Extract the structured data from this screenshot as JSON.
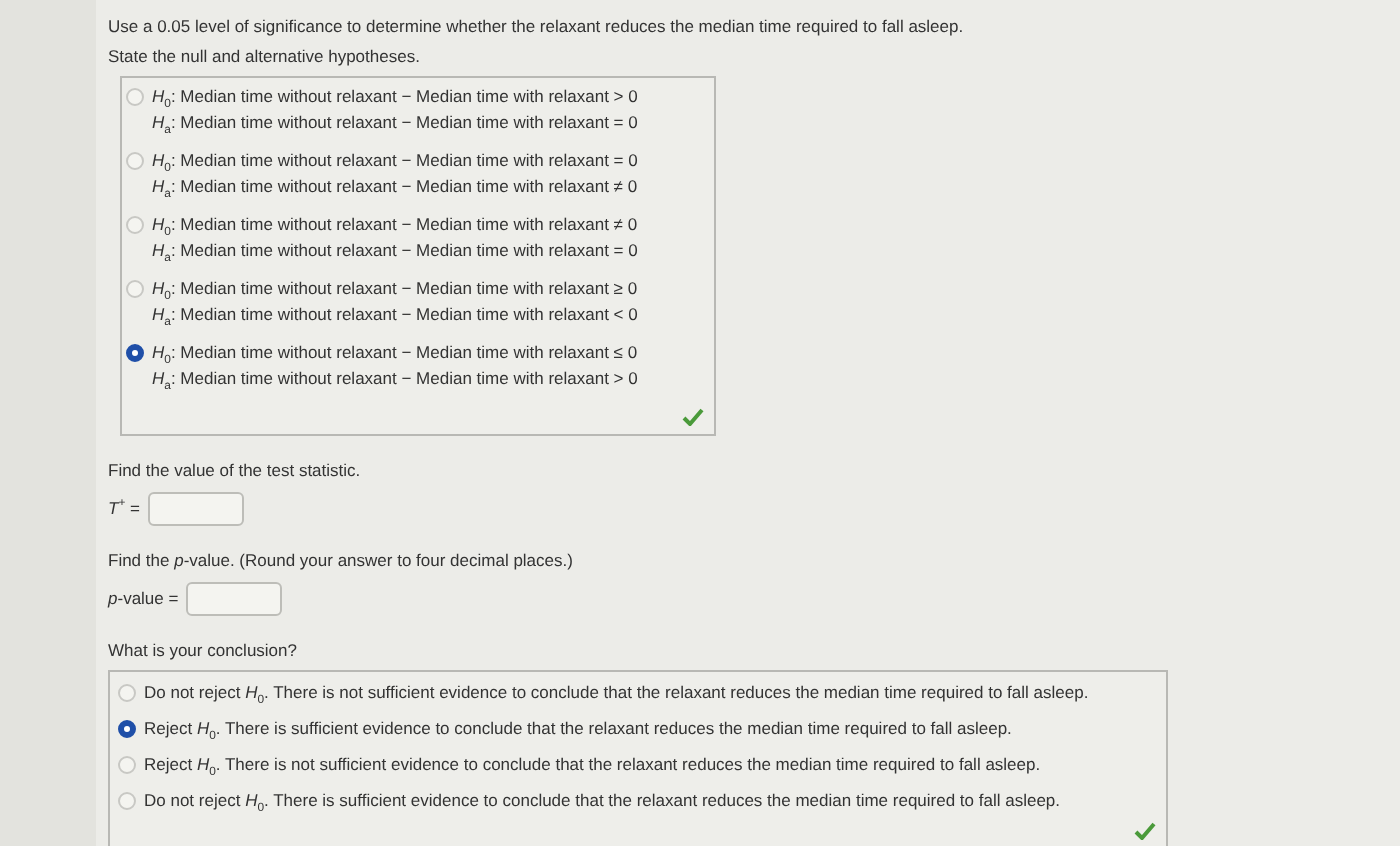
{
  "intro": "Use a 0.05 level of significance to determine whether the relaxant reduces the median time required to fall asleep.",
  "hypotheses": {
    "prompt": "State the null and alternative hypotheses.",
    "correct": true,
    "options": [
      {
        "h0": "*H*$_{0}$: Median time without relaxant − Median time with relaxant > 0",
        "ha": "*H*$_{a}$: Median time without relaxant − Median time with relaxant = 0",
        "selected": false
      },
      {
        "h0": "*H*$_{0}$: Median time without relaxant − Median time with relaxant = 0",
        "ha": "*H*$_{a}$: Median time without relaxant − Median time with relaxant ≠ 0",
        "selected": false
      },
      {
        "h0": "*H*$_{0}$: Median time without relaxant − Median time with relaxant ≠ 0",
        "ha": "*H*$_{a}$: Median time without relaxant − Median time with relaxant = 0",
        "selected": false
      },
      {
        "h0": "*H*$_{0}$: Median time without relaxant − Median time with relaxant ≥ 0",
        "ha": "*H*$_{a}$: Median time without relaxant − Median time with relaxant < 0",
        "selected": false
      },
      {
        "h0": "*H*$_{0}$: Median time without relaxant − Median time with relaxant ≤ 0",
        "ha": "*H*$_{a}$: Median time without relaxant − Median time with relaxant > 0",
        "selected": true
      }
    ]
  },
  "statistic": {
    "prompt": "Find the value of the test statistic.",
    "label": "*T*$^{+}$ ="
  },
  "pvalue": {
    "prompt": "Find the *p*-value. (Round your answer to four decimal places.)",
    "label": "*p*-value ="
  },
  "conclusion": {
    "prompt": "What is your conclusion?",
    "correct": true,
    "options": [
      {
        "text": "Do not reject *H*$_{0}$. There is not sufficient evidence to conclude that the relaxant reduces the median time required to fall asleep.",
        "selected": false
      },
      {
        "text": "Reject *H*$_{0}$. There is sufficient evidence to conclude that the relaxant reduces the median time required to fall asleep.",
        "selected": true
      },
      {
        "text": "Reject *H*$_{0}$. There is not sufficient evidence to conclude that the relaxant reduces the median time required to fall asleep.",
        "selected": false
      },
      {
        "text": "Do not reject *H*$_{0}$. There is sufficient evidence to conclude that the relaxant reduces the median time required to fall asleep.",
        "selected": false
      }
    ]
  }
}
